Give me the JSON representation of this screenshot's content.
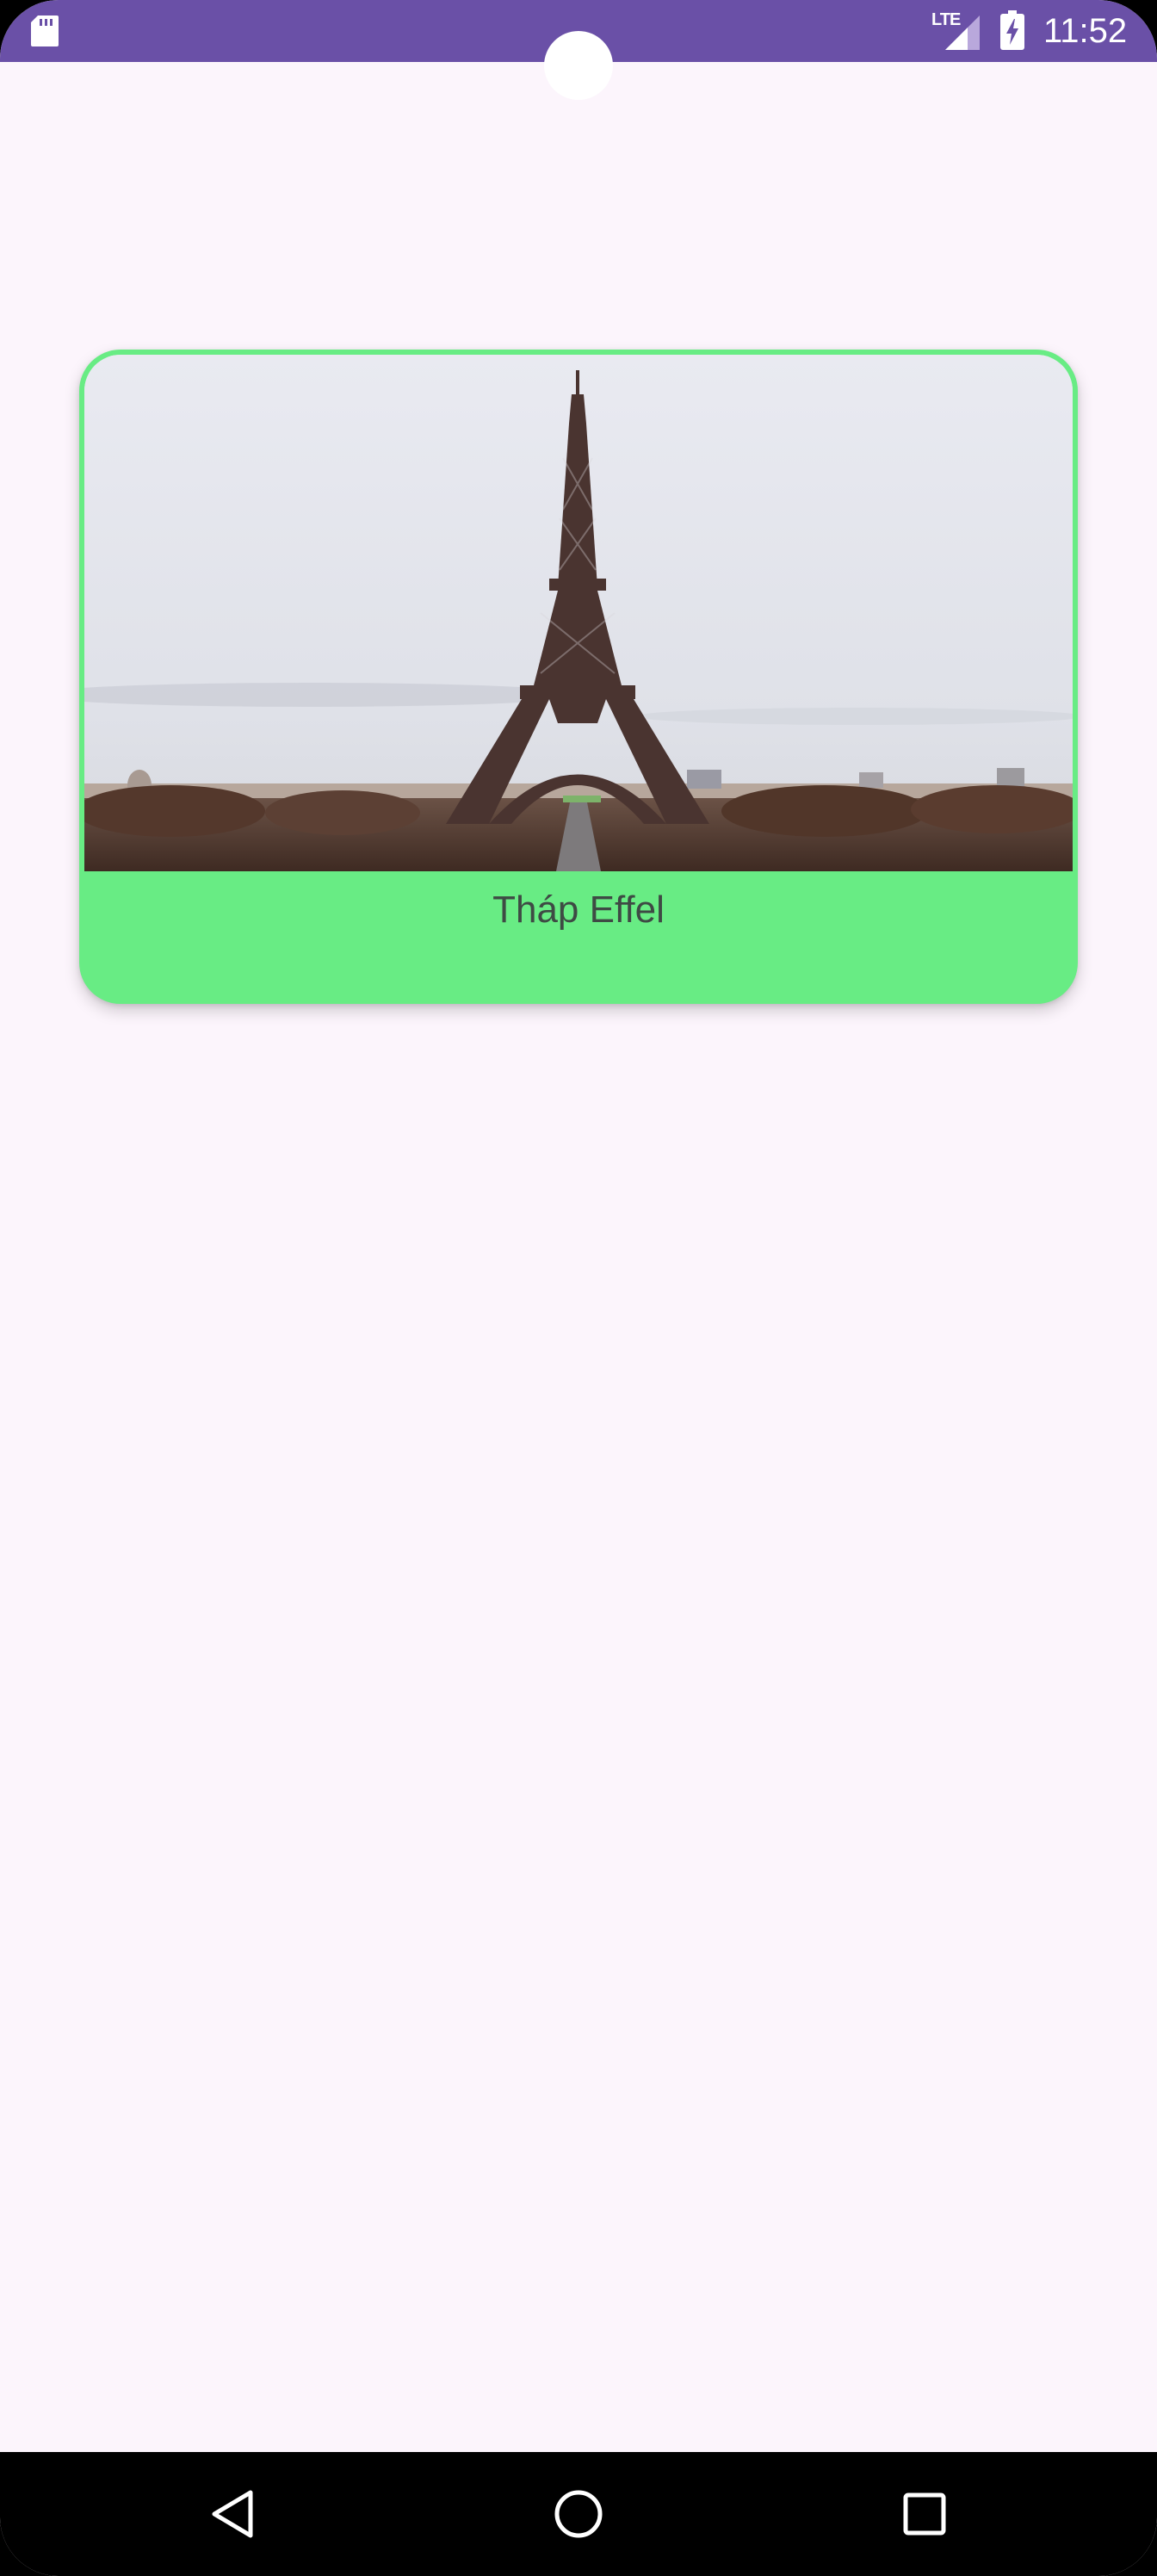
{
  "status_bar": {
    "time": "11:52",
    "network_label": "LTE",
    "icons": [
      "sd-card-icon",
      "lte-signal-icon",
      "battery-charging-icon"
    ],
    "background_color": "#6a50a7"
  },
  "card": {
    "image_description": "Eiffel Tower photo",
    "title": "Tháp Effel",
    "background_color": "#68ec84"
  },
  "navigation_bar": {
    "icons": [
      "back-icon",
      "home-icon",
      "recents-icon"
    ]
  },
  "colors": {
    "screen_background": "#fcf5fc",
    "accent": "#6a50a7",
    "card": "#68ec84"
  }
}
